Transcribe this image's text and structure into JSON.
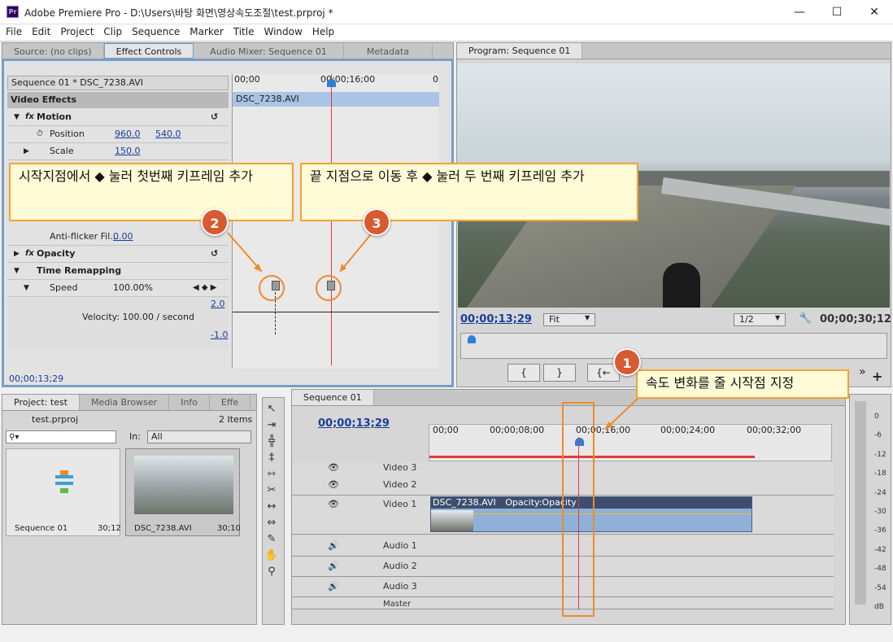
{
  "window": {
    "app_icon": "Pr",
    "title": "Adobe Premiere Pro - D:\\Users\\바탕 화면\\영상속도조절\\test.prproj *",
    "minimize": "—",
    "maximize": "☐",
    "close": "✕"
  },
  "menu": [
    "File",
    "Edit",
    "Project",
    "Clip",
    "Sequence",
    "Marker",
    "Title",
    "Window",
    "Help"
  ],
  "effect_panel": {
    "tabs": [
      "Source: (no clips)",
      "Effect Controls",
      "Audio Mixer: Sequence 01",
      "Metadata"
    ],
    "sequence_label": "Sequence 01 * DSC_7238.AVI",
    "ruler": {
      "start": "00;00",
      "mid": "00;00;16;00",
      "end": "0"
    },
    "clip_name": "DSC_7238.AVI",
    "video_effects": "Video Effects",
    "motion": "Motion",
    "position_label": "Position",
    "position_x": "960.0",
    "position_y": "540.0",
    "scale_label": "Scale",
    "scale_value": "150.0",
    "antiflicker_label": "Anti-flicker Fil...",
    "antiflicker_value": "0.00",
    "opacity": "Opacity",
    "time_remapping": "Time Remapping",
    "speed_label": "Speed",
    "speed_value": "100.00%",
    "graph_top": "2.0",
    "graph_bottom": "-1.0",
    "velocity": "Velocity: 100.00 / second",
    "timecode": "00;00;13;29"
  },
  "program": {
    "tab": "Program: Sequence 01",
    "timecode_left": "00;00;13;29",
    "fit": "Fit",
    "resolution": "1/2",
    "timecode_right": "00;00;30;12"
  },
  "project": {
    "tabs": [
      "Project: test",
      "Media Browser",
      "Info",
      "Effe"
    ],
    "file": "test.prproj",
    "items": "2 Items",
    "in_label": "In:",
    "in_value": "All",
    "items_list": [
      {
        "name": "Sequence 01",
        "dur": "30;12"
      },
      {
        "name": "DSC_7238.AVI",
        "dur": "30;10"
      }
    ]
  },
  "timeline": {
    "tab": "Sequence 01",
    "timecode": "00;00;13;29",
    "ruler": [
      "00;00",
      "00;00;08;00",
      "00;00;16;00",
      "00;00;24;00",
      "00;00;32;00"
    ],
    "tracks": [
      "Video 3",
      "Video 2",
      "Video 1",
      "Audio 1",
      "Audio 2",
      "Audio 3",
      "Master"
    ],
    "clip_name": "DSC_7238.AVI",
    "clip_fx": "Opacity:Opacity"
  },
  "meter": [
    "0",
    "-6",
    "-12",
    "-18",
    "-24",
    "-30",
    "-36",
    "-42",
    "-48",
    "-54",
    "dB"
  ],
  "callouts": {
    "c1": "속도 변화를 줄 시작점 지정",
    "c2": "시작지점에서 ◆ 눌러 첫번째 키프레임 추가",
    "c3": "끝 지점으로 이동 후 ◆ 눌러 두 번째 키프레임 추가",
    "n1": "1",
    "n2": "2",
    "n3": "3"
  },
  "colors": {
    "accent": "#1a3d99",
    "callout_border": "#f4a234",
    "badge": "#d95a30",
    "playhead": "#e03c3c"
  }
}
